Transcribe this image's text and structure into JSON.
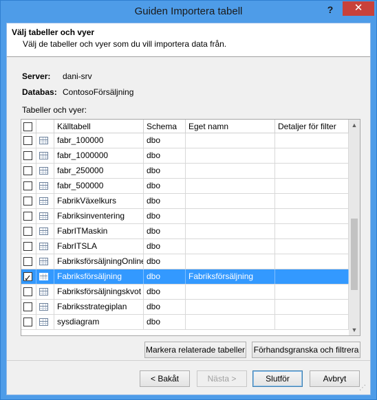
{
  "window": {
    "title": "Guiden Importera tabell",
    "help_label": "?",
    "close_label": "✕"
  },
  "header": {
    "title": "Välj tabeller och vyer",
    "subtitle": "Välj de tabeller och vyer som du vill importera data från."
  },
  "info": {
    "server_label": "Server:",
    "server_value": "dani-srv",
    "database_label": "Databas:",
    "database_value": "ContosoFörsäljning",
    "list_label": "Tabeller och vyer:"
  },
  "grid": {
    "columns": [
      "",
      "",
      "Källtabell",
      "Schema",
      "Eget namn",
      "Detaljer för filter"
    ],
    "rows": [
      {
        "checked": false,
        "source": "fabr_100000",
        "schema": "dbo",
        "friendly": "",
        "filter": ""
      },
      {
        "checked": false,
        "source": "fabr_1000000",
        "schema": "dbo",
        "friendly": "",
        "filter": ""
      },
      {
        "checked": false,
        "source": "fabr_250000",
        "schema": "dbo",
        "friendly": "",
        "filter": ""
      },
      {
        "checked": false,
        "source": "fabr_500000",
        "schema": "dbo",
        "friendly": "",
        "filter": ""
      },
      {
        "checked": false,
        "source": "FabrikVäxelkurs",
        "schema": "dbo",
        "friendly": "",
        "filter": ""
      },
      {
        "checked": false,
        "source": "Fabriksinventering",
        "schema": "dbo",
        "friendly": "",
        "filter": ""
      },
      {
        "checked": false,
        "source": "FabrITMaskin",
        "schema": "dbo",
        "friendly": "",
        "filter": ""
      },
      {
        "checked": false,
        "source": "FabrITSLA",
        "schema": "dbo",
        "friendly": "",
        "filter": ""
      },
      {
        "checked": false,
        "source": "FabriksförsäljningOnline",
        "schema": "dbo",
        "friendly": "",
        "filter": ""
      },
      {
        "checked": true,
        "selected": true,
        "source": "Fabriksförsäljning",
        "schema": "dbo",
        "friendly": "Fabriksförsäljning",
        "filter": ""
      },
      {
        "checked": false,
        "source": "Fabriksförsäljningskvot",
        "schema": "dbo",
        "friendly": "",
        "filter": ""
      },
      {
        "checked": false,
        "source": "Fabriksstrategiplan",
        "schema": "dbo",
        "friendly": "",
        "filter": ""
      },
      {
        "checked": false,
        "source": "sysdiagram",
        "schema": "dbo",
        "friendly": "",
        "filter": ""
      }
    ]
  },
  "buttons": {
    "select_related": "Markera relaterade tabeller",
    "preview_filter": "Förhandsgranska och filtrera",
    "back": "< Bakåt",
    "next": "Nästa >",
    "finish": "Slutför",
    "cancel": "Avbryt"
  },
  "scroll": {
    "up_glyph": "▲",
    "down_glyph": "▼"
  }
}
